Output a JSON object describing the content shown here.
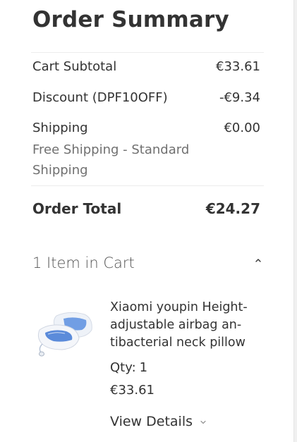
{
  "summary": {
    "title": "Order Summary",
    "subtotal_label": "Cart Subtotal",
    "subtotal_value": "€33.61",
    "discount_label": "Discount (DPF10OFF)",
    "discount_value": "-€9.34",
    "shipping_label": "Shipping",
    "shipping_value": "€0.00",
    "shipping_method": "Free Shipping - Standard Shipping",
    "total_label": "Order Total",
    "total_value": "€24.27"
  },
  "cart": {
    "header": "1 Item in Cart",
    "toggle_icon": "chevron-up-icon",
    "items": [
      {
        "name": "Xiaomi youpin Height-adjustable airbag an-tibacterial neck pillow",
        "qty_label": "Qty:",
        "qty": "1",
        "price": "€33.61",
        "image_icon": "neck-pillow-image",
        "details_label": "View Details",
        "details_icon": "chevron-down-icon"
      }
    ]
  },
  "colors": {
    "text": "#333333",
    "muted": "#707070",
    "divider": "#ececec",
    "pillow_blue": "#4a7fd6"
  }
}
